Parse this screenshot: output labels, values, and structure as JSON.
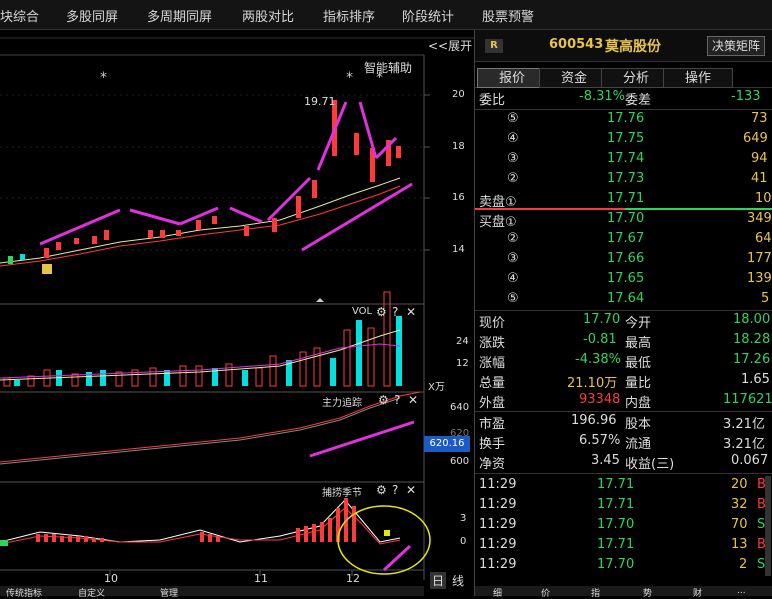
{
  "nav": [
    "块综合",
    "多股同屏",
    "多周期同屏",
    "两股对比",
    "指标排序",
    "阶段统计",
    "股票预警"
  ],
  "chart": {
    "expand": "<<展开",
    "assist": "智能辅助",
    "peak": "19.71",
    "price_axis": [
      "20",
      "18",
      "16",
      "14"
    ],
    "vol_title": "VOL",
    "vol_axis": [
      "24",
      "12"
    ],
    "vol_unit": "X万",
    "track_title": "主力追踪",
    "track_axis": [
      "640",
      "620",
      "600"
    ],
    "track_value": "620.16",
    "season_title": "捕捞季节",
    "season_axis": [
      "3",
      "0"
    ],
    "x_ticks": [
      "10",
      "11",
      "12"
    ],
    "period": "日",
    "line": "线",
    "bottom_tabs": [
      "传统指标",
      "自定义",
      "管理"
    ]
  },
  "quote": {
    "badge": "R",
    "code": "600543",
    "name": "莫高股份",
    "decision_btn": "决策矩阵",
    "tabs": [
      "报价",
      "资金",
      "分析",
      "操作"
    ],
    "weibi_label": "委比",
    "weibi": "-8.31%",
    "weicha_label": "委差",
    "weicha": "-133",
    "sells": [
      {
        "lvl": "⑤",
        "price": "17.76",
        "vol": "73"
      },
      {
        "lvl": "④",
        "price": "17.75",
        "vol": "649"
      },
      {
        "lvl": "③",
        "price": "17.74",
        "vol": "94"
      },
      {
        "lvl": "②",
        "price": "17.73",
        "vol": "41"
      },
      {
        "lvl": "卖盘①",
        "price": "17.71",
        "vol": "10"
      }
    ],
    "buys": [
      {
        "lvl": "买盘①",
        "price": "17.70",
        "vol": "349"
      },
      {
        "lvl": "②",
        "price": "17.67",
        "vol": "64"
      },
      {
        "lvl": "③",
        "price": "17.66",
        "vol": "177"
      },
      {
        "lvl": "④",
        "price": "17.65",
        "vol": "139"
      },
      {
        "lvl": "⑤",
        "price": "17.64",
        "vol": "5"
      }
    ],
    "stats": [
      {
        "l1": "现价",
        "v1": "17.70",
        "c1": "g",
        "l2": "今开",
        "v2": "18.00",
        "c2": "g"
      },
      {
        "l1": "涨跌",
        "v1": "-0.81",
        "c1": "g",
        "l2": "最高",
        "v2": "18.28",
        "c2": "g"
      },
      {
        "l1": "涨幅",
        "v1": "-4.38%",
        "c1": "g",
        "l2": "最低",
        "v2": "17.26",
        "c2": "g"
      },
      {
        "l1": "总量",
        "v1": "21.10万",
        "c1": "y",
        "l2": "量比",
        "v2": "1.65",
        "c2": "w"
      },
      {
        "l1": "外盘",
        "v1": "93348",
        "c1": "r",
        "l2": "内盘",
        "v2": "117621",
        "c2": "g"
      }
    ],
    "stats2": [
      {
        "l1": "市盈",
        "v1": "196.96",
        "l2": "股本",
        "v2": "3.21亿"
      },
      {
        "l1": "换手",
        "v1": "6.57%",
        "l2": "流通",
        "v2": "3.21亿"
      },
      {
        "l1": "净资",
        "v1": "3.45",
        "l2": "收益(三)",
        "v2": "0.067"
      }
    ],
    "ticks": [
      {
        "t": "11:29",
        "p": "17.71",
        "v": "20",
        "s": "B"
      },
      {
        "t": "11:29",
        "p": "17.71",
        "v": "32",
        "s": "B"
      },
      {
        "t": "11:29",
        "p": "17.70",
        "v": "70",
        "s": "S"
      },
      {
        "t": "11:29",
        "p": "17.71",
        "v": "13",
        "s": "B"
      },
      {
        "t": "11:29",
        "p": "17.70",
        "v": "2",
        "s": "S"
      }
    ],
    "bottom_tabs": [
      "细",
      "价",
      "指",
      "势",
      "财",
      "..."
    ]
  }
}
